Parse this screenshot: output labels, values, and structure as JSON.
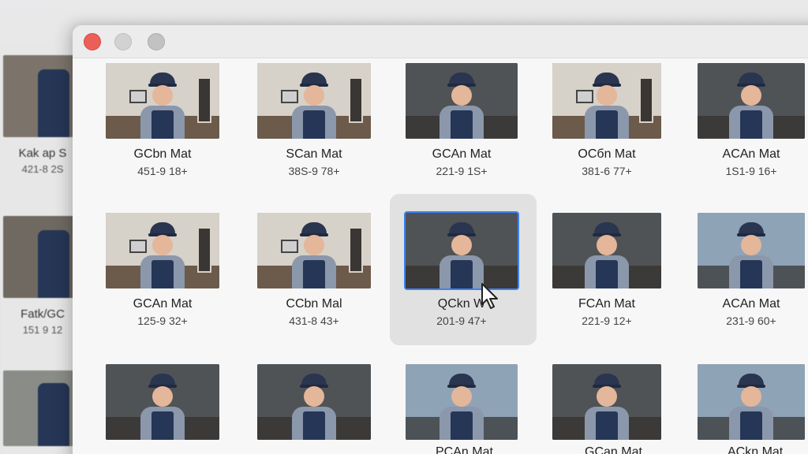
{
  "background_window": {
    "items": [
      {
        "name": "Kak ap S",
        "meta": "421-8 2S"
      },
      {
        "name": "Fatk/GC",
        "meta": "151 9 12"
      },
      {
        "name": "",
        "meta": ""
      }
    ]
  },
  "window": {
    "title_buttons": [
      "close",
      "minimize",
      "maximize"
    ],
    "items": [
      {
        "name": "GCbn Mat",
        "meta": "451-9 18+",
        "scene": "room"
      },
      {
        "name": "SCan Mat",
        "meta": "38S-9 78+",
        "scene": "room"
      },
      {
        "name": "GCAn Mat",
        "meta": "221-9 1S+",
        "scene": "shop"
      },
      {
        "name": "OCбn Mat",
        "meta": "381-6 77+",
        "scene": "room"
      },
      {
        "name": "ACAn Mat",
        "meta": "1S1-9 16+",
        "scene": "shop"
      },
      {
        "name": "GCAn Mat",
        "meta": "125-9 32+",
        "scene": "room"
      },
      {
        "name": "CCbn Mal",
        "meta": "431-8 43+",
        "scene": "room"
      },
      {
        "name": "QCkn W",
        "meta": "201-9 47+",
        "scene": "shop",
        "selected": true
      },
      {
        "name": "FCAn Mat",
        "meta": "221-9 12+",
        "scene": "shop"
      },
      {
        "name": "ACAn Mat",
        "meta": "231-9 60+",
        "scene": "street"
      },
      {
        "name": "",
        "meta": "",
        "scene": "shop"
      },
      {
        "name": "",
        "meta": "",
        "scene": "shop"
      },
      {
        "name": "",
        "meta": "",
        "scene": "street"
      },
      {
        "name": "",
        "meta": "",
        "scene": "shop"
      },
      {
        "name": "",
        "meta": "",
        "scene": "street"
      }
    ],
    "bottom_labels": [
      "",
      "PCAn Mat",
      "GCan Mat",
      "ACkn Mat"
    ]
  },
  "colors": {
    "close": "#ec5f59",
    "selection": "#e1e1e1",
    "focus_ring": "#3b82f6"
  }
}
